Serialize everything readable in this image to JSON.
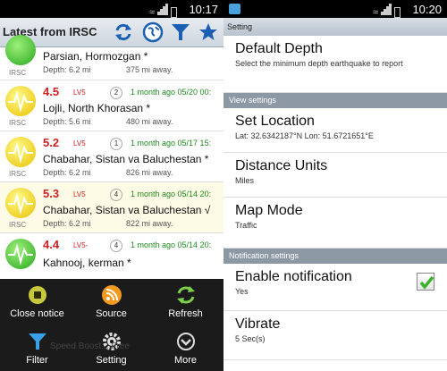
{
  "left": {
    "status_time": "10:17",
    "header_title": "Latest from IRSC",
    "header_icons": [
      "refresh-icon",
      "globe-icon",
      "filter-icon",
      "star-icon"
    ],
    "quakes": [
      {
        "place": "Parsian, Hormozgan *",
        "depth": "Depth: 6.2 mi",
        "distance": "375 mi away.",
        "source": "IRSC"
      },
      {
        "mag": "4.5",
        "level": "LV5",
        "count": "2",
        "ago": "1 month ago 05/20 00:",
        "place": "Lojli, North Khorasan *",
        "depth": "Depth: 5.6 mi",
        "distance": "480 mi away.",
        "source": "IRSC"
      },
      {
        "mag": "5.2",
        "level": "LV5",
        "count": "1",
        "ago": "1 month ago 05/17 15:",
        "place": "Chabahar, Sistan va Baluchestan *",
        "depth": "Depth: 6.2 mi",
        "distance": "826 mi away.",
        "source": "IRSC"
      },
      {
        "mag": "5.3",
        "level": "LV5",
        "count": "4",
        "ago": "1 month ago 05/14 20:",
        "place": "Chabahar, Sistan va Baluchestan √",
        "depth": "Depth: 6.2 mi",
        "distance": "822 mi away.",
        "source": "IRSC"
      },
      {
        "mag": "4.4",
        "level": "LV5-",
        "count": "4",
        "ago": "1 month ago 05/14 20:",
        "place": "Kahnooj, kerman *",
        "source": "IRSC"
      }
    ],
    "menu": [
      {
        "label": "Close notice",
        "icon": "close-notice-icon"
      },
      {
        "label": "Source",
        "icon": "rss-source-icon"
      },
      {
        "label": "Refresh",
        "icon": "refresh-icon"
      },
      {
        "label": "Filter",
        "icon": "filter-icon"
      },
      {
        "label": "Setting",
        "icon": "gear-icon"
      },
      {
        "label": "More",
        "icon": "more-icon"
      }
    ],
    "behind_text": "Speed Boost... Free"
  },
  "right": {
    "status_time": "10:20",
    "title": "Setting",
    "default_depth": {
      "title": "Default Depth",
      "summary": "Select the minimum depth earthquake to report"
    },
    "section_view": "View settings",
    "set_location": {
      "title": "Set Location",
      "summary": "Lat: 32.6342187°N  Lon: 51.6721651°E"
    },
    "distance_units": {
      "title": "Distance Units",
      "summary": "Miles"
    },
    "map_mode": {
      "title": "Map Mode",
      "summary": "Traffic"
    },
    "section_notification": "Notification settings",
    "enable_notification": {
      "title": "Enable notification",
      "summary": "Yes",
      "checked": true
    },
    "vibrate": {
      "title": "Vibrate",
      "summary": "5 Sec(s)"
    }
  },
  "colors": {
    "magnitude": "#d12020",
    "time_ago": "#1e8a1e",
    "accent_blue": "#1a5fb4",
    "section": "#8d98a5"
  }
}
